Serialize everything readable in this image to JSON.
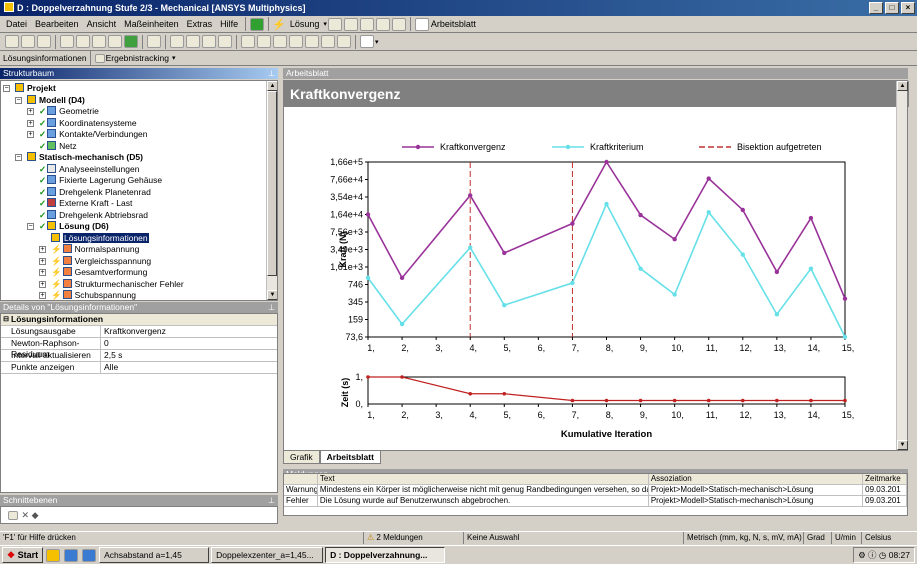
{
  "window": {
    "title": "D : Doppelverzahnung Stufe 2/3 - Mechanical [ANSYS Multiphysics]"
  },
  "menu": [
    "Datei",
    "Bearbeiten",
    "Ansicht",
    "Maßeinheiten",
    "Extras",
    "Hilfe"
  ],
  "toolbar": {
    "solve_label": "Lösung",
    "worksheet_label": "Arbeitsblatt"
  },
  "toolbar3": {
    "solution_info_label": "Lösungsinformationen",
    "result_tracking_label": "Ergebnistracking"
  },
  "tree": {
    "header": "Strukturbaum",
    "items": [
      {
        "label": "Projekt",
        "bold": true
      },
      {
        "label": "Modell (D4)",
        "bold": true
      },
      {
        "label": "Geometrie"
      },
      {
        "label": "Koordinatensysteme"
      },
      {
        "label": "Kontakte/Verbindungen"
      },
      {
        "label": "Netz"
      },
      {
        "label": "Statisch-mechanisch (D5)",
        "bold": true
      },
      {
        "label": "Analyseeinstellungen"
      },
      {
        "label": "Fixierte Lagerung Gehäuse"
      },
      {
        "label": "Drehgelenk Planetenrad"
      },
      {
        "label": "Externe Kraft - Last"
      },
      {
        "label": "Drehgelenk Abtriebsrad"
      },
      {
        "label": "Lösung (D6)",
        "bold": true
      },
      {
        "label": "Lösungsinformationen",
        "selected": true
      },
      {
        "label": "Normalspannung"
      },
      {
        "label": "Vergleichsspannung"
      },
      {
        "label": "Gesamtverformung"
      },
      {
        "label": "Strukturmechanischer Fehler"
      },
      {
        "label": "Schubspannung"
      }
    ]
  },
  "details": {
    "header": "Details von \"Lösungsinformationen\"",
    "section": "Lösungsinformationen",
    "rows": [
      {
        "key": "Lösungsausgabe",
        "value": "Kraftkonvergenz"
      },
      {
        "key": "Newton-Raphson-Residuum",
        "value": "0"
      },
      {
        "key": "Intervall aktualisieren",
        "value": "2,5 s"
      },
      {
        "key": "Punkte anzeigen",
        "value": "Alle"
      }
    ]
  },
  "section_planes": {
    "header": "Schnittebenen"
  },
  "worksheet": {
    "header": "Arbeitsblatt",
    "title": "Kraftkonvergenz",
    "tabs": [
      "Grafik",
      "Arbeitsblatt"
    ]
  },
  "chart_data": [
    {
      "type": "line",
      "ylabel": "Kraft (N)",
      "yscale": "log",
      "yticks": [
        "73,6",
        "159",
        "345",
        "746",
        "1,61e+3",
        "3,49e+3",
        "7,56e+3",
        "1,64e+4",
        "3,54e+4",
        "7,66e+4",
        "1,66e+5"
      ],
      "x": [
        1,
        2,
        3,
        4,
        5,
        6,
        7,
        8,
        9,
        10,
        11,
        12,
        13,
        14,
        15
      ],
      "xtick_labels": [
        "1,",
        "2,",
        "3,",
        "4,",
        "5,",
        "6,",
        "7,",
        "8,",
        "9,",
        "10,",
        "11,",
        "12,",
        "13,",
        "14,",
        "15,"
      ],
      "legend": [
        "Kraftkonvergenz",
        "Kraftkriterium",
        "Bisektion aufgetreten"
      ],
      "legend_position": "top",
      "series": [
        {
          "name": "Kraftkonvergenz",
          "color": "#993399",
          "x": [
            1,
            2,
            4,
            5,
            7,
            8,
            9,
            10,
            11,
            12,
            13,
            14,
            15
          ],
          "values": [
            16400,
            1000,
            38000,
            3000,
            11000,
            166000,
            16000,
            5500,
            80000,
            20000,
            1300,
            14000,
            400
          ]
        },
        {
          "name": "Kraftkriterium",
          "color": "#66e0e8",
          "x": [
            1,
            2,
            4,
            5,
            7,
            8,
            9,
            10,
            11,
            12,
            13,
            14,
            15
          ],
          "values": [
            1000,
            130,
            3800,
            300,
            800,
            26000,
            1500,
            480,
            18000,
            2800,
            200,
            1500,
            73.6
          ]
        }
      ],
      "bisection_x": [
        4,
        7
      ],
      "bisection_color": "#c03030"
    },
    {
      "type": "line",
      "ylabel": "Zeit (s)",
      "xlabel": "Kumulative Iteration",
      "yticks": [
        "0,",
        "1,"
      ],
      "ylim": [
        0,
        1
      ],
      "x": [
        1,
        2,
        3,
        4,
        5,
        6,
        7,
        8,
        9,
        10,
        11,
        12,
        13,
        14,
        15
      ],
      "xtick_labels": [
        "1,",
        "2,",
        "3,",
        "4,",
        "5,",
        "6,",
        "7,",
        "8,",
        "9,",
        "10,",
        "11,",
        "12,",
        "13,",
        "14,",
        "15,"
      ],
      "series": [
        {
          "name": "",
          "color": "#c02020",
          "x": [
            1,
            2,
            4,
            5,
            7,
            8,
            9,
            10,
            11,
            12,
            13,
            14,
            15
          ],
          "values": [
            1,
            1,
            0.38,
            0.38,
            0.13,
            0.13,
            0.13,
            0.13,
            0.13,
            0.13,
            0.13,
            0.13,
            0.13
          ]
        }
      ]
    }
  ],
  "messages": {
    "header": "Meldungen",
    "columns": [
      "",
      "Text",
      "Assoziation",
      "Zeitmarke"
    ],
    "rows": [
      {
        "type": "Warnung",
        "text": "Mindestens ein Körper ist möglicherweise nicht mit genug Randbedingungen versehen, so dass s",
        "assoc": "Projekt>Modell>Statisch-mechanisch>Lösung",
        "time": "09.03.201"
      },
      {
        "type": "Fehler",
        "text": "Die Lösung wurde auf Benutzerwunsch abgebrochen.",
        "assoc": "Projekt>Modell>Statisch-mechanisch>Lösung",
        "time": "09.03.201"
      }
    ]
  },
  "status": {
    "help": "'F1' für Hilfe drücken",
    "messages": "2 Meldungen",
    "selection": "Keine Auswahl",
    "units": "Metrisch (mm, kg, N, s, mV, mA)",
    "deg": "Grad",
    "rpm": "U/min",
    "temp": "Celsius"
  },
  "taskbar": {
    "start": "Start",
    "items": [
      "Achsabstand a=1,45",
      "Doppelexzenter_a=1,45...",
      "D : Doppelverzahnung..."
    ],
    "clock": "08:27"
  }
}
